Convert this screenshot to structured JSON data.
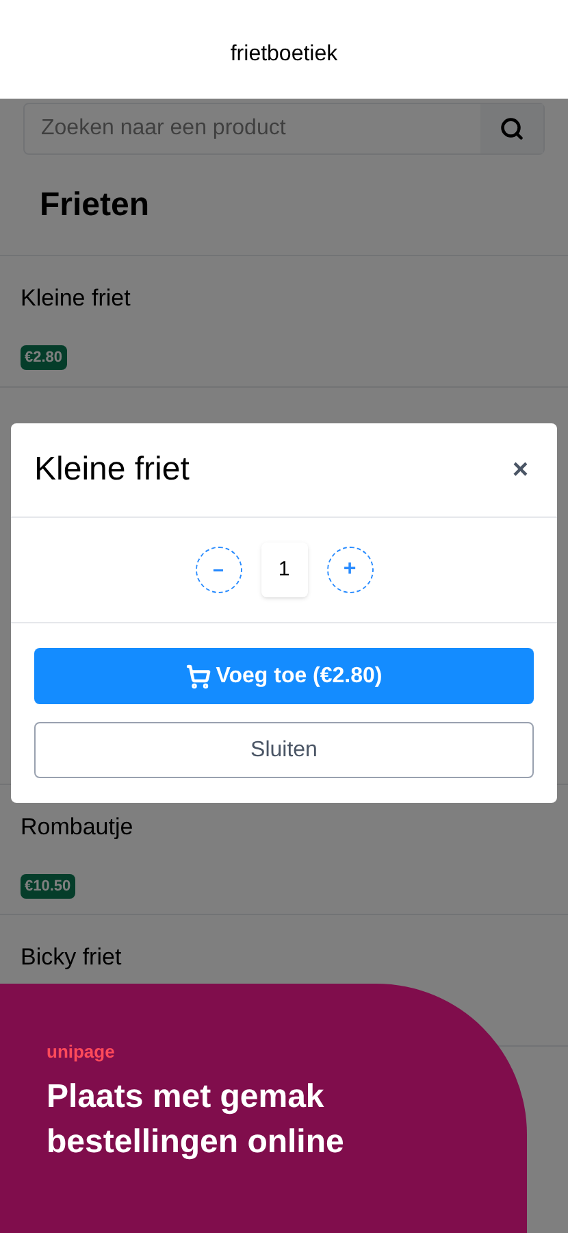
{
  "header": {
    "title": "frietboetiek"
  },
  "search": {
    "placeholder": "Zoeken naar een product"
  },
  "category": {
    "title": "Frieten"
  },
  "products": [
    {
      "name": "Kleine friet",
      "price": "€2.80"
    },
    {
      "name": "Rombautje",
      "price": "€10.50"
    },
    {
      "name": "Bicky friet"
    }
  ],
  "modal": {
    "title": "Kleine friet",
    "close": "×",
    "quantity": "1",
    "minus": "−",
    "plus": "+",
    "add_button": "Voeg toe (€2.80)",
    "close_button": "Sluiten"
  },
  "banner": {
    "logo": "unipage",
    "headline": "Plaats met gemak bestellingen online"
  }
}
